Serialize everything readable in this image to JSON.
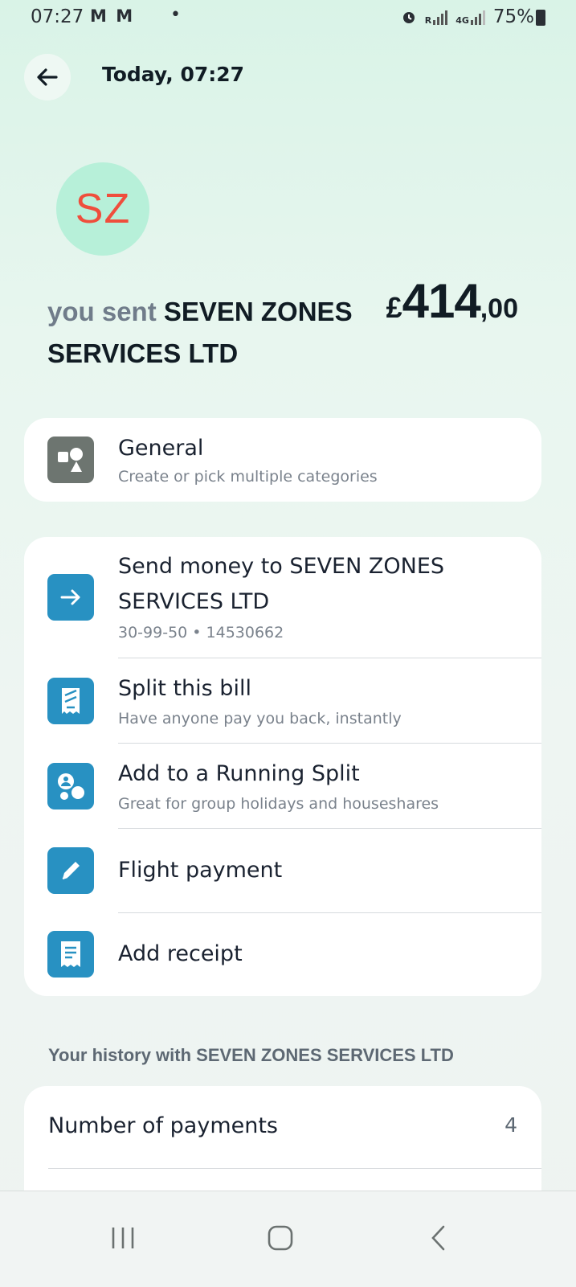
{
  "status_bar": {
    "time": "07:27",
    "notification_icons": "M M",
    "dot": "•",
    "signal_r": "R",
    "network": "4G",
    "battery": "75%"
  },
  "header": {
    "title": "Today, 07:27",
    "back_icon": "arrow-left-icon"
  },
  "payee": {
    "initials": "SZ",
    "avatar_bg": "#b7f0d9",
    "initials_color": "#ef4e3c"
  },
  "summary": {
    "prefix": "you sent ",
    "payee_name": "SEVEN ZONES SERVICES LTD",
    "currency": "£",
    "amount_major": "414",
    "amount_minor": ",00"
  },
  "category": {
    "title": "General",
    "subtitle": "Create or pick multiple categories",
    "icon": "shapes-icon"
  },
  "actions": [
    {
      "title": "Send money to SEVEN ZONES SERVICES LTD",
      "subtitle": "30-99-50 • 14530662",
      "icon": "arrow-right-icon"
    },
    {
      "title": "Split this bill",
      "subtitle": "Have anyone pay you back, instantly",
      "icon": "split-bill-icon"
    },
    {
      "title": "Add to a Running Split",
      "subtitle": "Great for group holidays and houseshares",
      "icon": "running-split-icon"
    },
    {
      "title": "Flight payment",
      "subtitle": "",
      "icon": "pencil-icon"
    },
    {
      "title": "Add receipt",
      "subtitle": "",
      "icon": "receipt-icon"
    }
  ],
  "history": {
    "heading": "Your history with SEVEN ZONES SERVICES LTD",
    "rows": [
      {
        "label": "Number of payments",
        "value": "4"
      }
    ]
  },
  "colors": {
    "accent_blue": "#2891c2",
    "category_gray": "#6d7570"
  },
  "nav": {
    "recents_icon": "recents-icon",
    "home_icon": "home-icon",
    "back_icon": "back-chevron-icon"
  }
}
